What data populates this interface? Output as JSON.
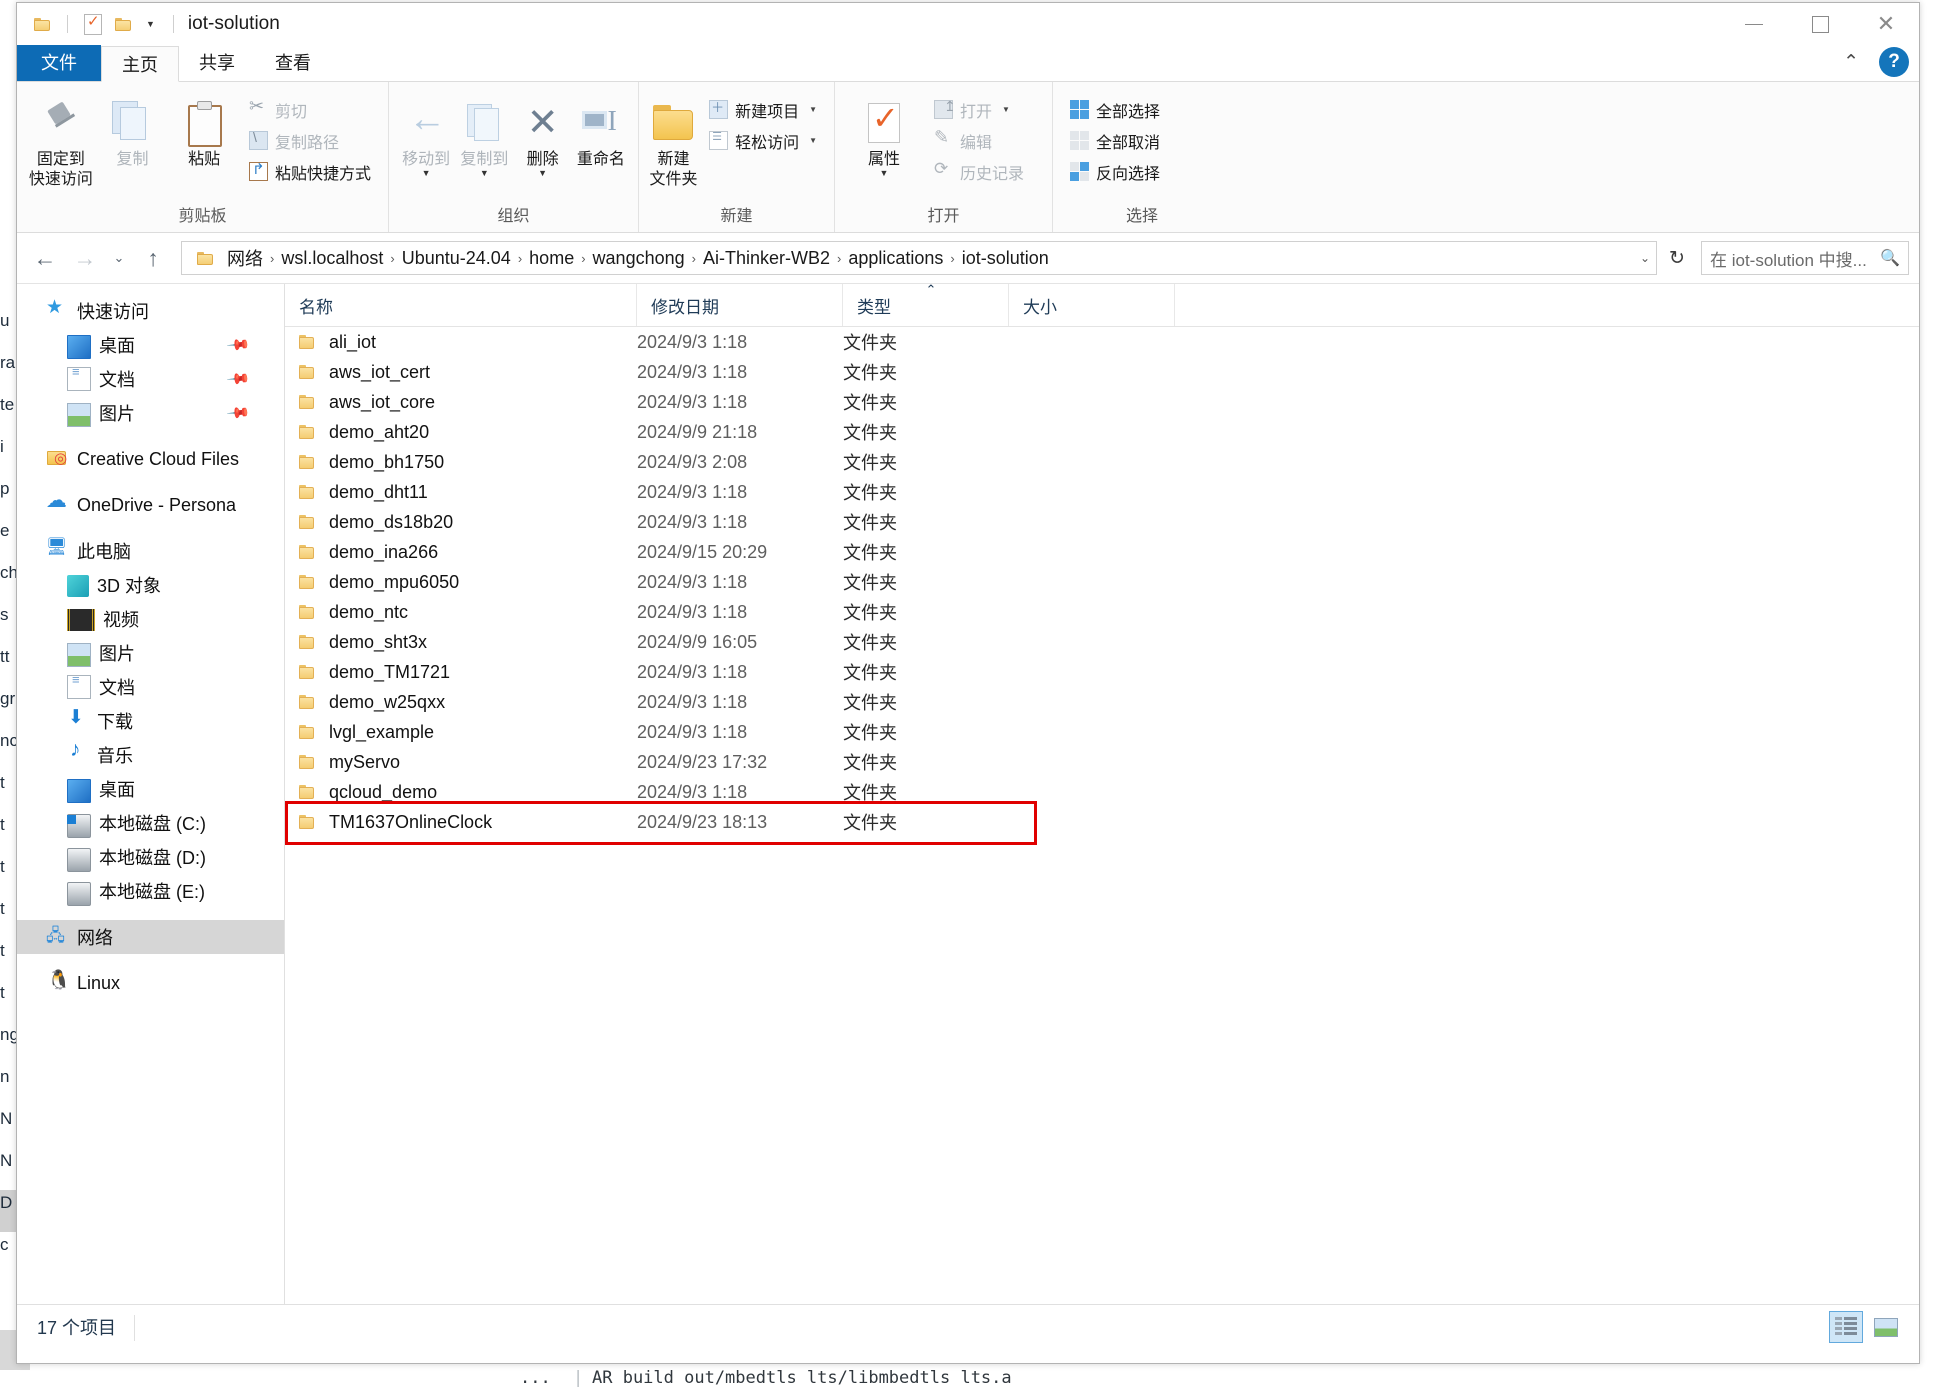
{
  "window": {
    "title": "iot-solution",
    "minimize_label": "最小化",
    "maximize_label": "最大化",
    "close_label": "关闭"
  },
  "quick_access_toolbar": {
    "items": [
      {
        "name": "folder-icon",
        "label": ""
      },
      {
        "name": "properties-icon",
        "label": ""
      },
      {
        "name": "new-folder-icon",
        "label": ""
      },
      {
        "name": "customize-caret",
        "label": "▼"
      }
    ]
  },
  "ribbon": {
    "tabs": [
      {
        "id": "file",
        "label": "文件",
        "active": false,
        "is_file_menu": true
      },
      {
        "id": "home",
        "label": "主页",
        "active": true,
        "is_file_menu": false
      },
      {
        "id": "share",
        "label": "共享",
        "active": false,
        "is_file_menu": false
      },
      {
        "id": "view",
        "label": "查看",
        "active": false,
        "is_file_menu": false
      }
    ],
    "collapse_icon": "⌃",
    "help_icon": "?",
    "groups": [
      {
        "label": "剪贴板",
        "big_buttons": [
          {
            "label": "固定到\n快速访问",
            "icon": "pin-icon",
            "dim": false,
            "caret": false
          },
          {
            "label": "复制",
            "icon": "copy-icon",
            "dim": true,
            "caret": false
          },
          {
            "label": "粘贴",
            "icon": "paste-icon",
            "dim": false,
            "caret": false
          }
        ],
        "small_buttons": [
          {
            "label": "剪切",
            "icon": "scissors-icon",
            "dim": true,
            "caret": false
          },
          {
            "label": "复制路径",
            "icon": "copy-path-icon",
            "dim": true,
            "caret": false
          },
          {
            "label": "粘贴快捷方式",
            "icon": "paste-shortcut-icon",
            "dim": false,
            "caret": false
          }
        ]
      },
      {
        "label": "组织",
        "big_buttons": [
          {
            "label": "移动到",
            "icon": "move-to-icon",
            "dim": true,
            "caret": true
          },
          {
            "label": "复制到",
            "icon": "copy-to-icon",
            "dim": true,
            "caret": true
          },
          {
            "label": "删除",
            "icon": "delete-icon",
            "dim": false,
            "caret": true
          },
          {
            "label": "重命名",
            "icon": "rename-icon",
            "dim": false,
            "caret": false
          }
        ],
        "small_buttons": []
      },
      {
        "label": "新建",
        "big_buttons": [
          {
            "label": "新建\n文件夹",
            "icon": "new-folder-icon",
            "dim": false,
            "caret": false
          }
        ],
        "small_buttons": [
          {
            "label": "新建项目",
            "icon": "new-item-icon",
            "dim": false,
            "caret": true
          },
          {
            "label": "轻松访问",
            "icon": "easy-access-icon",
            "dim": false,
            "caret": true
          }
        ]
      },
      {
        "label": "打开",
        "big_buttons": [
          {
            "label": "属性",
            "icon": "properties-icon",
            "dim": false,
            "caret": true
          }
        ],
        "small_buttons": [
          {
            "label": "打开",
            "icon": "open-icon",
            "dim": true,
            "caret": true
          },
          {
            "label": "编辑",
            "icon": "edit-icon",
            "dim": true,
            "caret": false
          },
          {
            "label": "历史记录",
            "icon": "history-icon",
            "dim": true,
            "caret": false
          }
        ]
      },
      {
        "label": "选择",
        "big_buttons": [],
        "small_buttons": [
          {
            "label": "全部选择",
            "icon": "select-all-icon",
            "dim": false,
            "caret": false
          },
          {
            "label": "全部取消",
            "icon": "select-none-icon",
            "dim": false,
            "caret": false
          },
          {
            "label": "反向选择",
            "icon": "invert-selection-icon",
            "dim": false,
            "caret": false
          }
        ]
      }
    ]
  },
  "address_bar": {
    "back_icon": "←",
    "forward_icon": "→",
    "recent_caret": "⌄",
    "up_icon": "↑",
    "breadcrumbs": [
      "网络",
      "wsl.localhost",
      "Ubuntu-24.04",
      "home",
      "wangchong",
      "Ai-Thinker-WB2",
      "applications",
      "iot-solution"
    ],
    "separator": "›",
    "dropdown_caret": "⌄",
    "refresh_icon": "↻"
  },
  "search": {
    "placeholder": "在 iot-solution 中搜...",
    "icon": "search-icon"
  },
  "sidebar": {
    "items": [
      {
        "label": "快速访问",
        "icon": "star-icon",
        "indent": 0,
        "pinned": false,
        "selected": false,
        "gap_before": false
      },
      {
        "label": "桌面",
        "icon": "desktop-icon",
        "indent": 1,
        "pinned": true,
        "selected": false,
        "gap_before": false
      },
      {
        "label": "文档",
        "icon": "documents-icon",
        "indent": 1,
        "pinned": true,
        "selected": false,
        "gap_before": false
      },
      {
        "label": "图片",
        "icon": "pictures-icon",
        "indent": 1,
        "pinned": true,
        "selected": false,
        "gap_before": false
      },
      {
        "label": "Creative Cloud Files",
        "icon": "creative-cloud-icon",
        "indent": 0,
        "pinned": false,
        "selected": false,
        "gap_before": true
      },
      {
        "label": "OneDrive - Persona",
        "icon": "onedrive-icon",
        "indent": 0,
        "pinned": false,
        "selected": false,
        "gap_before": true
      },
      {
        "label": "此电脑",
        "icon": "this-pc-icon",
        "indent": 0,
        "pinned": false,
        "selected": false,
        "gap_before": true
      },
      {
        "label": "3D 对象",
        "icon": "3d-objects-icon",
        "indent": 1,
        "pinned": false,
        "selected": false,
        "gap_before": false
      },
      {
        "label": "视频",
        "icon": "videos-icon",
        "indent": 1,
        "pinned": false,
        "selected": false,
        "gap_before": false
      },
      {
        "label": "图片",
        "icon": "pictures-icon",
        "indent": 1,
        "pinned": false,
        "selected": false,
        "gap_before": false
      },
      {
        "label": "文档",
        "icon": "documents-icon",
        "indent": 1,
        "pinned": false,
        "selected": false,
        "gap_before": false
      },
      {
        "label": "下载",
        "icon": "downloads-icon",
        "indent": 1,
        "pinned": false,
        "selected": false,
        "gap_before": false
      },
      {
        "label": "音乐",
        "icon": "music-icon",
        "indent": 1,
        "pinned": false,
        "selected": false,
        "gap_before": false
      },
      {
        "label": "桌面",
        "icon": "desktop-icon",
        "indent": 1,
        "pinned": false,
        "selected": false,
        "gap_before": false
      },
      {
        "label": "本地磁盘 (C:)",
        "icon": "drive-c-icon",
        "indent": 1,
        "pinned": false,
        "selected": false,
        "gap_before": false
      },
      {
        "label": "本地磁盘 (D:)",
        "icon": "drive-icon",
        "indent": 1,
        "pinned": false,
        "selected": false,
        "gap_before": false
      },
      {
        "label": "本地磁盘 (E:)",
        "icon": "drive-icon",
        "indent": 1,
        "pinned": false,
        "selected": false,
        "gap_before": false
      },
      {
        "label": "网络",
        "icon": "network-icon",
        "indent": 0,
        "pinned": false,
        "selected": true,
        "gap_before": true
      },
      {
        "label": "Linux",
        "icon": "linux-icon",
        "indent": 0,
        "pinned": false,
        "selected": false,
        "gap_before": true
      }
    ]
  },
  "file_list": {
    "columns": [
      {
        "key": "name",
        "label": "名称",
        "sorted": false
      },
      {
        "key": "date",
        "label": "修改日期",
        "sorted": false
      },
      {
        "key": "type",
        "label": "类型",
        "sorted": true,
        "sort_caret": "⌃"
      },
      {
        "key": "size",
        "label": "大小",
        "sorted": false
      }
    ],
    "rows": [
      {
        "name": "ali_iot",
        "date": "2024/9/3 1:18",
        "type": "文件夹",
        "size": "",
        "highlighted": false
      },
      {
        "name": "aws_iot_cert",
        "date": "2024/9/3 1:18",
        "type": "文件夹",
        "size": "",
        "highlighted": false
      },
      {
        "name": "aws_iot_core",
        "date": "2024/9/3 1:18",
        "type": "文件夹",
        "size": "",
        "highlighted": false
      },
      {
        "name": "demo_aht20",
        "date": "2024/9/9 21:18",
        "type": "文件夹",
        "size": "",
        "highlighted": false
      },
      {
        "name": "demo_bh1750",
        "date": "2024/9/3 2:08",
        "type": "文件夹",
        "size": "",
        "highlighted": false
      },
      {
        "name": "demo_dht11",
        "date": "2024/9/3 1:18",
        "type": "文件夹",
        "size": "",
        "highlighted": false
      },
      {
        "name": "demo_ds18b20",
        "date": "2024/9/3 1:18",
        "type": "文件夹",
        "size": "",
        "highlighted": false
      },
      {
        "name": "demo_ina266",
        "date": "2024/9/15 20:29",
        "type": "文件夹",
        "size": "",
        "highlighted": false
      },
      {
        "name": "demo_mpu6050",
        "date": "2024/9/3 1:18",
        "type": "文件夹",
        "size": "",
        "highlighted": false
      },
      {
        "name": "demo_ntc",
        "date": "2024/9/3 1:18",
        "type": "文件夹",
        "size": "",
        "highlighted": false
      },
      {
        "name": "demo_sht3x",
        "date": "2024/9/9 16:05",
        "type": "文件夹",
        "size": "",
        "highlighted": false
      },
      {
        "name": "demo_TM1721",
        "date": "2024/9/3 1:18",
        "type": "文件夹",
        "size": "",
        "highlighted": false
      },
      {
        "name": "demo_w25qxx",
        "date": "2024/9/3 1:18",
        "type": "文件夹",
        "size": "",
        "highlighted": false
      },
      {
        "name": "lvgl_example",
        "date": "2024/9/3 1:18",
        "type": "文件夹",
        "size": "",
        "highlighted": false
      },
      {
        "name": "myServo",
        "date": "2024/9/23 17:32",
        "type": "文件夹",
        "size": "",
        "highlighted": false
      },
      {
        "name": "qcloud_demo",
        "date": "2024/9/3 1:18",
        "type": "文件夹",
        "size": "",
        "highlighted": false
      },
      {
        "name": "TM1637OnlineClock",
        "date": "2024/9/23 18:13",
        "type": "文件夹",
        "size": "",
        "highlighted": true
      }
    ],
    "highlight_color": "#e00000"
  },
  "status_bar": {
    "item_count": "17 个项目",
    "view_buttons": [
      {
        "name": "details-view",
        "active": true
      },
      {
        "name": "thumbnail-view",
        "active": false
      }
    ]
  },
  "background": {
    "terminal_dots": "...",
    "terminal_separator": "|",
    "terminal_command": "AR build out/mbedtls lts/libmbedtls lts.a",
    "left_column_chars": [
      "u",
      "ra",
      "te",
      "i",
      "p",
      "e",
      "ch",
      "s",
      "tt",
      "gr",
      "nc",
      "t",
      "t",
      "t",
      "t",
      "t",
      "t",
      "ng",
      "n",
      "N",
      "N",
      "D",
      "c"
    ]
  }
}
